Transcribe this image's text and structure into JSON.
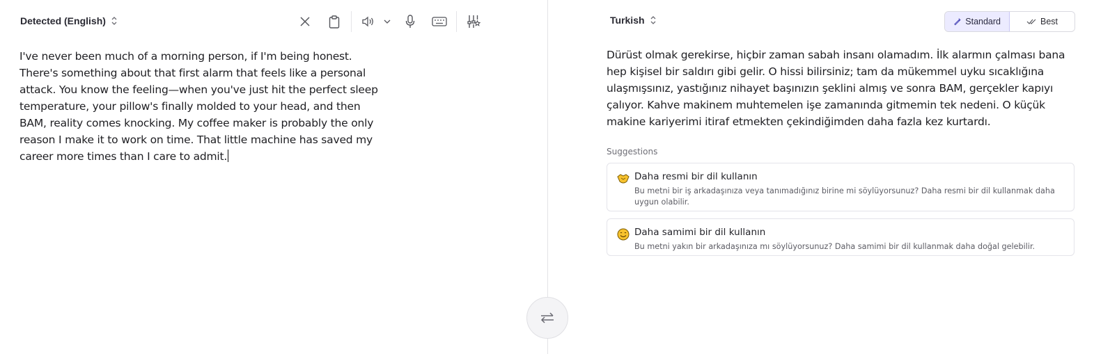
{
  "source": {
    "language_label": "Detected (English)",
    "text": "I've never been much of a morning person, if I'm being honest. There's something about that first alarm that feels like a personal attack. You know the feeling—when you've just hit the perfect sleep temperature, your pillow's finally molded to your head, and then BAM, reality comes knocking. My coffee maker is probably the only reason I make it to work on time. That little machine has saved my career more times than I care to admit."
  },
  "toolbar": {
    "icons": [
      "close-icon",
      "clipboard-icon",
      "speaker-icon",
      "chevron-down-icon",
      "microphone-icon",
      "keyboard-icon",
      "settings-sliders-icon"
    ]
  },
  "target": {
    "language_label": "Turkish",
    "modes": {
      "standard_label": "Standard",
      "best_label": "Best",
      "active": "Standard"
    },
    "text": "Dürüst olmak gerekirse, hiçbir zaman sabah insanı olamadım. İlk alarmın çalması bana hep kişisel bir saldırı gibi gelir. O hissi bilirsiniz; tam da mükemmel uyku sıcaklığına ulaşmışsınız, yastığınız nihayet başınızın şeklini almış ve sonra BAM, gerçekler kapıyı çalıyor. Kahve makinem muhtemelen işe zamanında gitmemin tek nedeni. O küçük makine kariyerimi itiraf etmekten çekindiğimden daha fazla kez kurtardı."
  },
  "suggestions": {
    "heading": "Suggestions",
    "items": [
      {
        "icon": "handshake-icon",
        "title": "Daha resmi bir dil kullanın",
        "description": "Bu metni bir iş arkadaşınıza veya tanımadığınız birine mi söylüyorsunuz? Daha resmi bir dil kullanmak daha uygun olabilir."
      },
      {
        "icon": "smiley-icon",
        "title": "Daha samimi bir dil kullanın",
        "description": "Bu metni yakın bir arkadaşınıza mı söylüyorsunuz? Daha samimi bir dil kullanmak daha doğal gelebilir."
      }
    ]
  },
  "colors": {
    "accent_active_bg": "#ecebff",
    "emoji_yellow": "#f7c22e",
    "divider": "#e2e2e6"
  }
}
